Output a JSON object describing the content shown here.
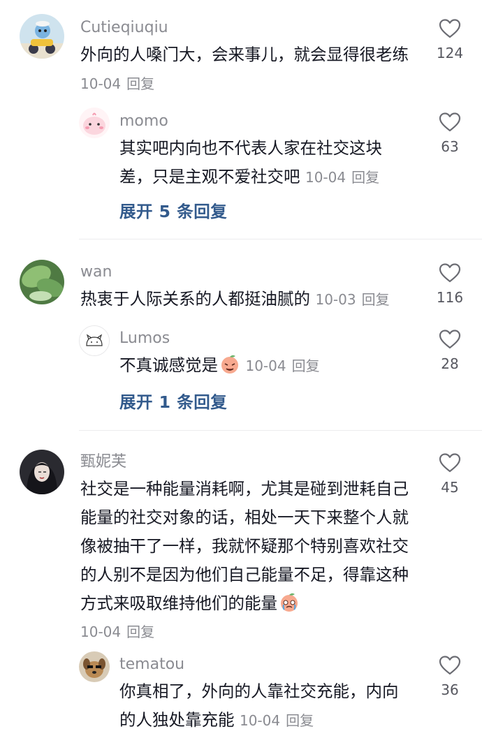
{
  "comments": [
    {
      "user": "Cutieqiuqiu",
      "text": "外向的人嗓门大，会来事儿，就会显得很老练",
      "time": "10-04",
      "reply": "回复",
      "likes": "124",
      "avatar_icon": "scooter-character-avatar",
      "replies": [
        {
          "user": "momo",
          "text": "其实吧内向也不代表人家在社交这块差，只是主观不爱社交吧",
          "time": "10-04",
          "reply": "回复",
          "likes": "63",
          "avatar_icon": "pink-cartoon-avatar"
        }
      ],
      "expand": "展开 5 条回复"
    },
    {
      "user": "wan",
      "text": "热衷于人际关系的人都挺油腻的",
      "time": "10-03",
      "reply": "回复",
      "likes": "116",
      "avatar_icon": "green-leaf-avatar",
      "replies": [
        {
          "user": "Lumos",
          "text": "不真诚感觉是",
          "time": "10-04",
          "reply": "回复",
          "likes": "28",
          "avatar_icon": "line-drawn-cat-avatar",
          "emoji": "peach-face-emoji"
        }
      ],
      "expand": "展开 1 条回复"
    },
    {
      "user": "甄妮芙",
      "text": "社交是一种能量消耗啊，尤其是碰到泄耗自己能量的社交对象的话，相处一天下来整个人就像被抽干了一样，我就怀疑那个特别喜欢社交的人别不是因为他们自己能量不足，得靠这种方式来吸取维持他们的能量",
      "time": "10-04",
      "reply": "回复",
      "likes": "45",
      "avatar_icon": "dark-hair-portrait-avatar",
      "emoji": "crying-peach-emoji",
      "replies": [
        {
          "user": "tematou",
          "text": "你真相了，外向的人靠社交充能，内向的人独处靠充能",
          "time": "10-04",
          "reply": "回复",
          "likes": "36",
          "avatar_icon": "dog-photo-avatar"
        }
      ]
    }
  ],
  "colors": {
    "username": "#8a8b91",
    "text": "#161823",
    "expand_link": "#325a8c",
    "divider": "#ececee"
  }
}
